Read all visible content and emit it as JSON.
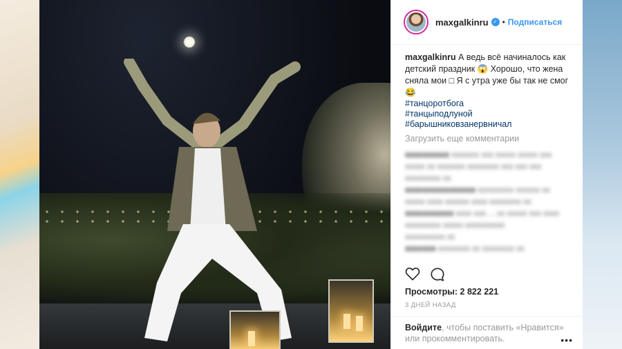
{
  "post": {
    "username": "maxgalkinru",
    "follow_label": "Подписаться",
    "separator": "•",
    "caption_text": "А ведь всё начиналось как детский праздник 😱 Хорошо, что жена сняла мои □ Я с утра уже бы так не смог 😂",
    "hashtags": [
      "#танцоротбога",
      "#танцыподлуной",
      "#барышниковзанервничал"
    ],
    "load_more": "Загрузить еще комментарии",
    "views_label": "Просмотры:",
    "views_count": "2 822 221",
    "time_ago": "3 ДНЕЙ НАЗАД",
    "login_link": "Войдите",
    "login_text": ", чтобы поставить «Нравится» или прокомментировать.",
    "more_label": "•••"
  },
  "icons": [
    "heart-icon",
    "comment-icon",
    "verified-badge-icon",
    "more-options-icon"
  ],
  "colors": {
    "accent": "#3897f0",
    "hashtag": "#003569",
    "muted": "#999999",
    "text": "#262626"
  }
}
